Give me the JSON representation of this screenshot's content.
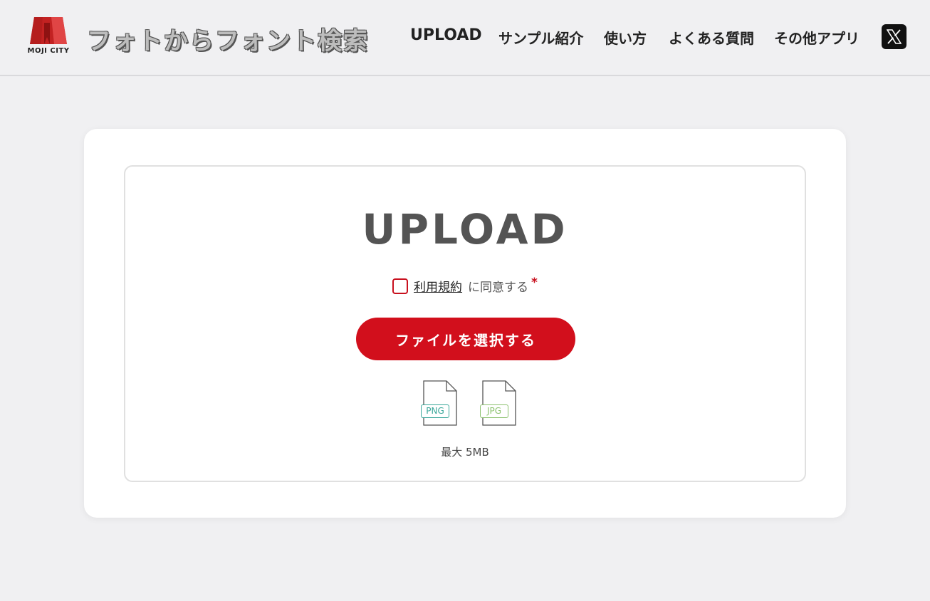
{
  "header": {
    "logo_text": "MOJI CITY",
    "site_title": "フォトからフォント検索",
    "nav": [
      {
        "label": "UPLOAD"
      },
      {
        "label": "サンプル紹介"
      },
      {
        "label": "使い方"
      },
      {
        "label": "よくある質問"
      },
      {
        "label": "その他アプリ"
      }
    ],
    "social_icon": "x-icon"
  },
  "upload": {
    "heading": "UPLOAD",
    "terms_link": "利用規約",
    "agree_text": "に同意する",
    "required_mark": "*",
    "checkbox_checked": false,
    "select_button": "ファイルを選択する",
    "formats": [
      {
        "label": "PNG",
        "color": "#3aa79a"
      },
      {
        "label": "JPG",
        "color": "#8dc26f"
      }
    ],
    "max_size": "最大 5MB"
  },
  "colors": {
    "accent": "#d20f1c",
    "background": "#f0f0f2",
    "card": "#ffffff"
  }
}
